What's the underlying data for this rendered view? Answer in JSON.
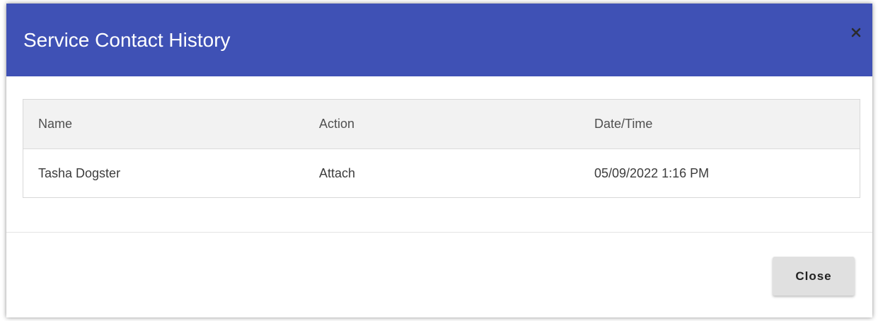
{
  "dialog": {
    "title": "Service Contact History",
    "close_icon": "close-icon",
    "header_color": "#3f51b5"
  },
  "table": {
    "columns": [
      "Name",
      "Action",
      "Date/Time"
    ],
    "rows": [
      {
        "name": "Tasha Dogster",
        "action": "Attach",
        "datetime": "05/09/2022 1:16 PM"
      }
    ]
  },
  "footer": {
    "close_label": "Close"
  }
}
